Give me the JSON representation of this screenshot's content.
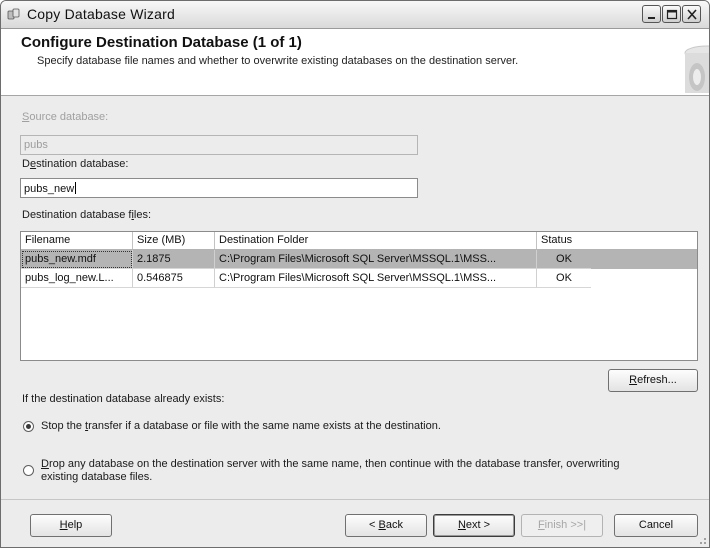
{
  "window": {
    "title": "Copy Database Wizard"
  },
  "header": {
    "title": "Configure Destination Database (1 of 1)",
    "subtitle": "Specify database file names and whether to overwrite existing databases on the destination server."
  },
  "source": {
    "label_mnemonic": "S",
    "label_rest": "ource database:",
    "value": "pubs"
  },
  "destination": {
    "label_pre": "D",
    "label_mnemonic": "e",
    "label_rest": "stination database:",
    "value": "pubs_new"
  },
  "files": {
    "label_pre": "Destination database f",
    "label_mnemonic": "i",
    "label_rest": "les:",
    "columns": [
      "Filename",
      "Size (MB)",
      "Destination Folder",
      "Status"
    ],
    "rows": [
      {
        "filename": "pubs_new.mdf",
        "size": "2.1875",
        "folder": "C:\\Program Files\\Microsoft SQL Server\\MSSQL.1\\MSS...",
        "status": "OK"
      },
      {
        "filename": "pubs_log_new.L...",
        "size": "0.546875",
        "folder": "C:\\Program Files\\Microsoft SQL Server\\MSSQL.1\\MSS...",
        "status": "OK"
      }
    ]
  },
  "refresh": {
    "mnemonic": "R",
    "rest": "efresh..."
  },
  "exists": {
    "label": "If the destination database already exists:",
    "option_stop": {
      "pre": "Stop the ",
      "mnemonic": "t",
      "rest": "ransfer if a database or file with the same name exists at the destination.",
      "selected": true
    },
    "option_drop": {
      "mnemonic": "D",
      "line1_rest": "rop any database on the destination server with the same name, then continue with the database transfer, overwriting",
      "line2": "existing database files.",
      "selected": false
    }
  },
  "footer": {
    "help": {
      "mnemonic": "H",
      "rest": "elp"
    },
    "back": {
      "pre": "< ",
      "mnemonic": "B",
      "rest": "ack"
    },
    "next": {
      "mnemonic": "N",
      "rest": "ext >"
    },
    "finish": {
      "mnemonic": "F",
      "rest": "inish >>|"
    },
    "cancel": "Cancel"
  },
  "colors": {
    "selected_row": "#b4b4b4",
    "dialog_bg": "#ececec",
    "header_bg": "#ffffff"
  }
}
